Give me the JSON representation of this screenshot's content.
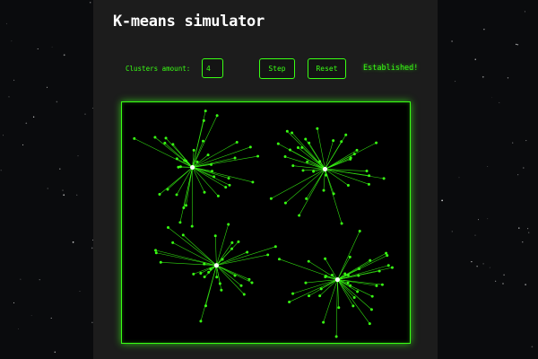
{
  "app": {
    "title": "K-means simulator"
  },
  "controls": {
    "clusters_label": "Clusters amount:",
    "clusters_value": "4",
    "step_label": "Step",
    "reset_label": "Reset",
    "status": "Established!"
  },
  "colors": {
    "accent": "#39ff14",
    "centroid": "#ffffff",
    "panel": "#1c1c1c",
    "background": "#0a0b0d"
  }
}
